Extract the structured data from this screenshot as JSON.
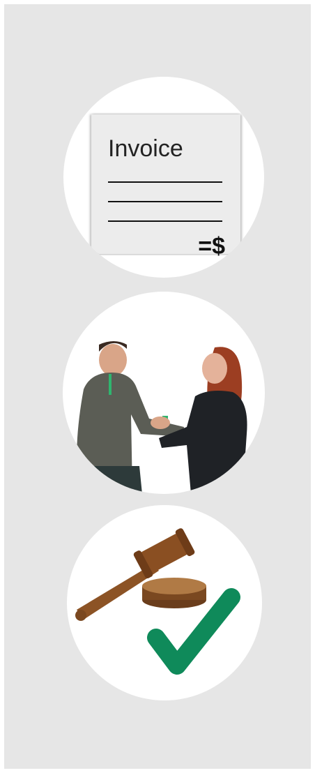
{
  "cards": [
    {
      "icon": "invoice-icon",
      "title": "Invoice",
      "amount": "=$"
    },
    {
      "icon": "handshake-icon"
    },
    {
      "icon": "gavel-check-icon",
      "accent": "#0f8a5a"
    }
  ]
}
